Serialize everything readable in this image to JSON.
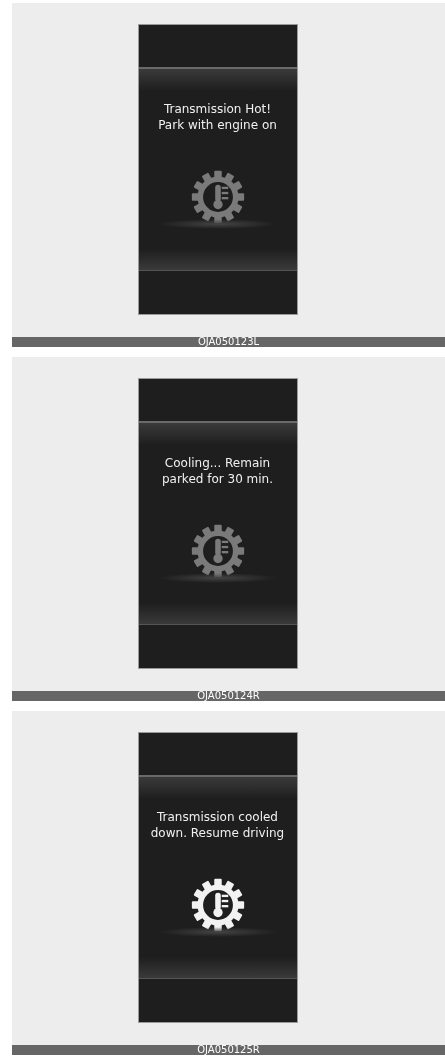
{
  "figures": [
    {
      "message": "Transmission Hot!\nPark with engine on",
      "icon_active": false,
      "caption": "OJA050123L"
    },
    {
      "message": "Cooling... Remain\nparked for 30 min.",
      "icon_active": false,
      "caption": "OJA050124R"
    },
    {
      "message": "Transmission cooled\ndown. Resume driving",
      "icon_active": true,
      "caption": "OJA050125R"
    }
  ]
}
